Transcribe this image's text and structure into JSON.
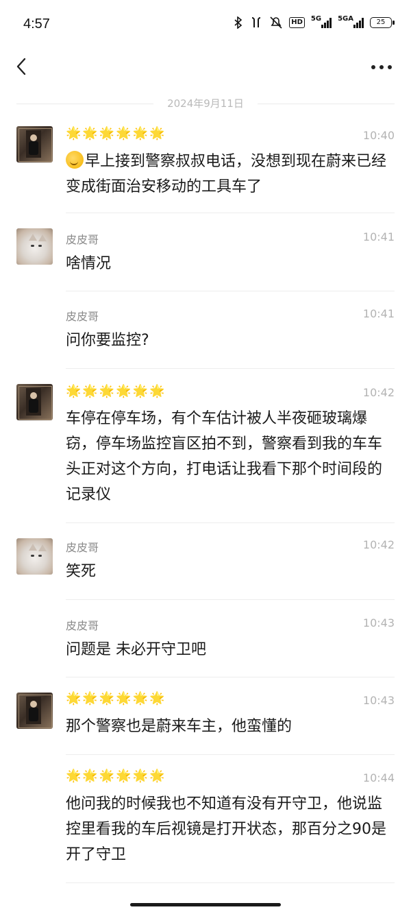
{
  "status_bar": {
    "time": "4:57",
    "network_1": "5G",
    "network_2": "5GA",
    "hd_label": "HD",
    "battery": "25"
  },
  "date_separator": "2024年9月11日",
  "messages": [
    {
      "sender": "",
      "stars": "🌟🌟🌟🌟🌟🌟",
      "time": "10:40",
      "text": "早上接到警察叔叔电话，没想到现在蔚来已经变成街面治安移动的工具车了"
    },
    {
      "sender": "皮皮哥",
      "stars": "",
      "time": "10:41",
      "text": "啥情况"
    },
    {
      "sender": "皮皮哥",
      "stars": "",
      "time": "10:41",
      "text": "问你要监控?"
    },
    {
      "sender": "",
      "stars": "🌟🌟🌟🌟🌟🌟",
      "time": "10:42",
      "text": "车停在停车场，有个车估计被人半夜砸玻璃爆窃，停车场监控盲区拍不到，警察看到我的车车头正对这个方向，打电话让我看下那个时间段的记录仪"
    },
    {
      "sender": "皮皮哥",
      "stars": "",
      "time": "10:42",
      "text": "笑死"
    },
    {
      "sender": "皮皮哥",
      "stars": "",
      "time": "10:43",
      "text": "问题是 未必开守卫吧"
    },
    {
      "sender": "",
      "stars": "🌟🌟🌟🌟🌟🌟",
      "time": "10:43",
      "text": "那个警察也是蔚来车主，他蛮懂的"
    },
    {
      "sender": "",
      "stars": "🌟🌟🌟🌟🌟🌟",
      "time": "10:44",
      "text": "他问我的时候我也不知道有没有开守卫，他说监控里看我的车后视镜是打开状态，那百分之90是开了守卫"
    }
  ]
}
